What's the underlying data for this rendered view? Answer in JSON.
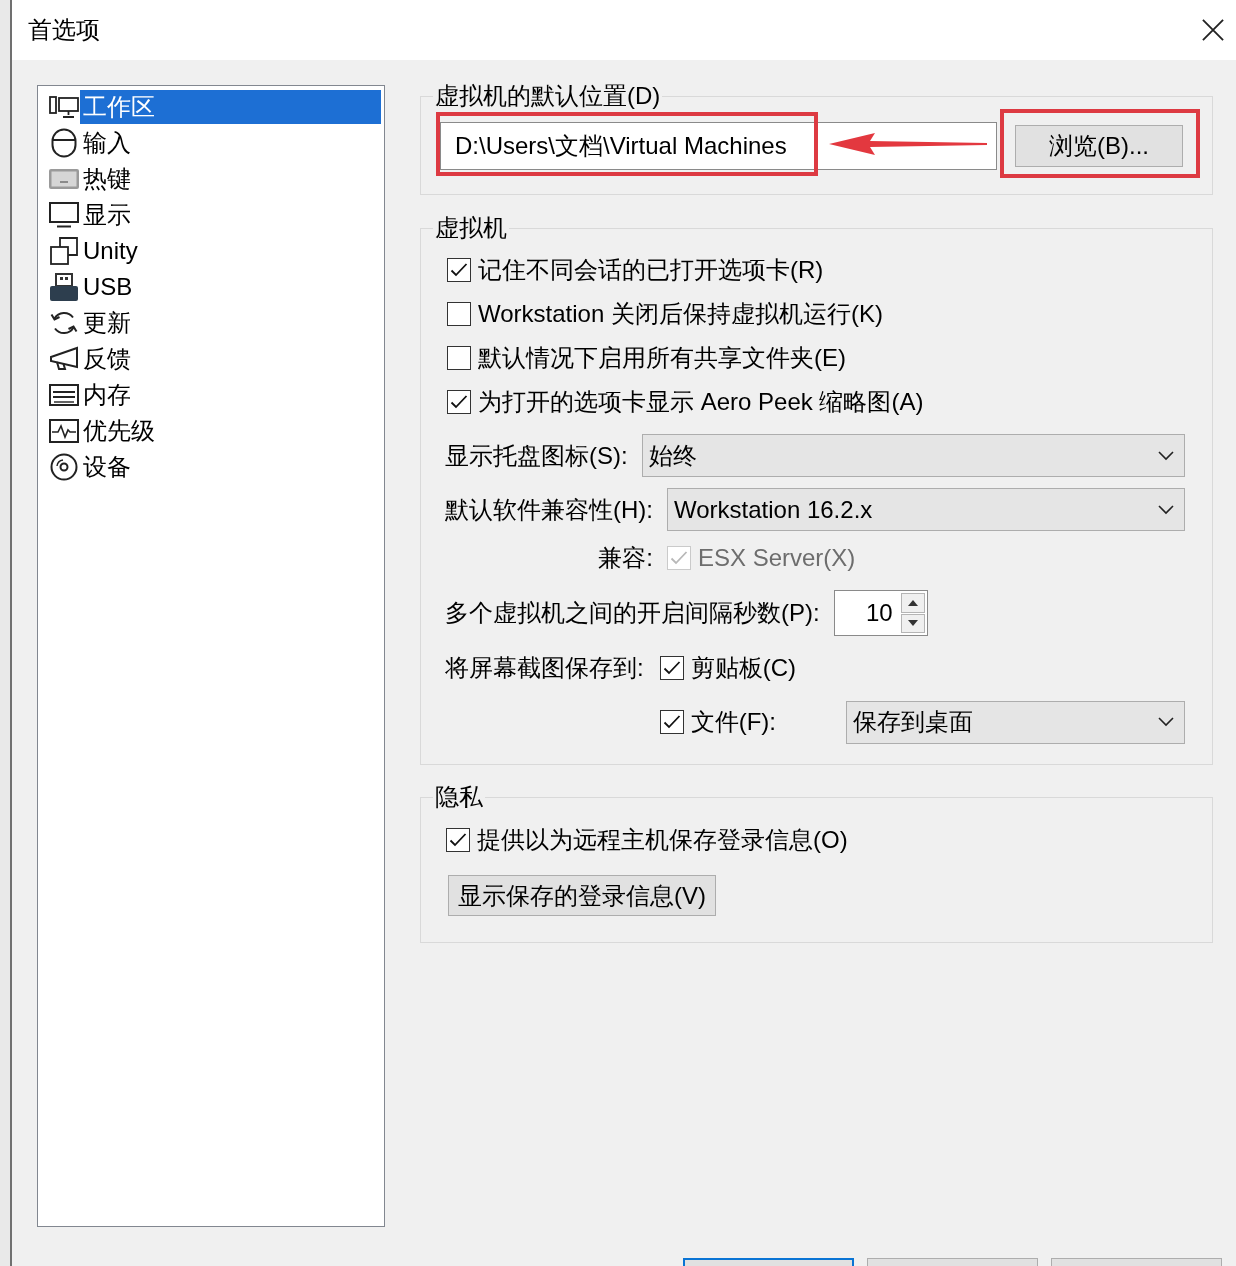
{
  "window": {
    "title": "首选项"
  },
  "sidebar": {
    "items": [
      {
        "label": "工作区",
        "selected": true
      },
      {
        "label": "输入",
        "selected": false
      },
      {
        "label": "热键",
        "selected": false
      },
      {
        "label": "显示",
        "selected": false
      },
      {
        "label": "Unity",
        "selected": false
      },
      {
        "label": "USB",
        "selected": false
      },
      {
        "label": "更新",
        "selected": false
      },
      {
        "label": "反馈",
        "selected": false
      },
      {
        "label": "内存",
        "selected": false
      },
      {
        "label": "优先级",
        "selected": false
      },
      {
        "label": "设备",
        "selected": false
      }
    ]
  },
  "default_location": {
    "title": "虚拟机的默认位置(D)",
    "path": {
      "value": "D:\\Users\\文档\\Virtual Machines",
      "highlighted": true
    },
    "browse_button": {
      "label": "浏览(B)...",
      "highlighted": true
    },
    "pointer_arrow": true
  },
  "virtual_machines": {
    "title": "虚拟机",
    "options": [
      {
        "label": "记住不同会话的已打开选项卡(R)",
        "checked": true
      },
      {
        "label": "Workstation 关闭后保持虚拟机运行(K)",
        "checked": false
      },
      {
        "label": "默认情况下启用所有共享文件夹(E)",
        "checked": false
      },
      {
        "label": "为打开的选项卡显示 Aero Peek 缩略图(A)",
        "checked": true
      }
    ],
    "tray_icon": {
      "label": "显示托盘图标(S):",
      "value": "始终"
    },
    "hardware_compatibility": {
      "label": "默认软件兼容性(H):",
      "value": "Workstation 16.2.x"
    },
    "compatible_with": {
      "label": "兼容:",
      "option": {
        "label": "ESX Server(X)",
        "checked": true,
        "disabled": true
      }
    },
    "power_on_delay": {
      "label": "多个虚拟机之间的开启间隔秒数(P):",
      "value": "10"
    },
    "screenshots": {
      "label": "将屏幕截图保存到:",
      "clipboard": {
        "label": "剪贴板(C)",
        "checked": true
      },
      "file": {
        "label": "文件(F):",
        "checked": true
      },
      "file_location": "保存到桌面"
    }
  },
  "privacy": {
    "title": "隐私",
    "option": {
      "label": "提供以为远程主机保存登录信息(O)",
      "checked": true
    },
    "button": "显示保存的登录信息(V)"
  },
  "dialog_buttons": [
    {
      "default": true
    },
    {
      "default": false
    },
    {
      "default": false
    }
  ]
}
